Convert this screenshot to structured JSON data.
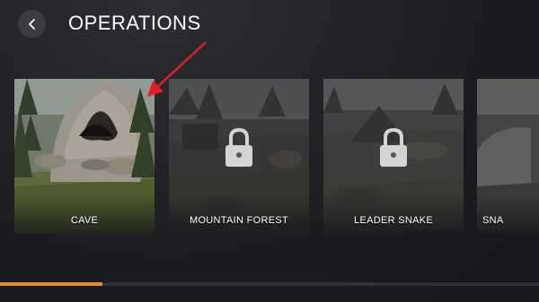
{
  "header": {
    "title": "OPERATIONS",
    "back_icon": "chevron-left-icon"
  },
  "operations": [
    {
      "label": "CAVE",
      "locked": false,
      "selected": true
    },
    {
      "label": "MOUNTAIN FOREST",
      "locked": true,
      "selected": false
    },
    {
      "label": "LEADER SNAKE",
      "locked": true,
      "selected": false
    },
    {
      "label": "SNA",
      "locked": true,
      "selected": false
    }
  ],
  "scroll": {
    "position_fraction": 0.19
  },
  "colors": {
    "accent": "#e88a2c",
    "annotation": "#e02020",
    "background": "#1c1d21"
  },
  "icons": {
    "lock": "lock-icon",
    "annotation": "arrow-annotation-icon"
  }
}
